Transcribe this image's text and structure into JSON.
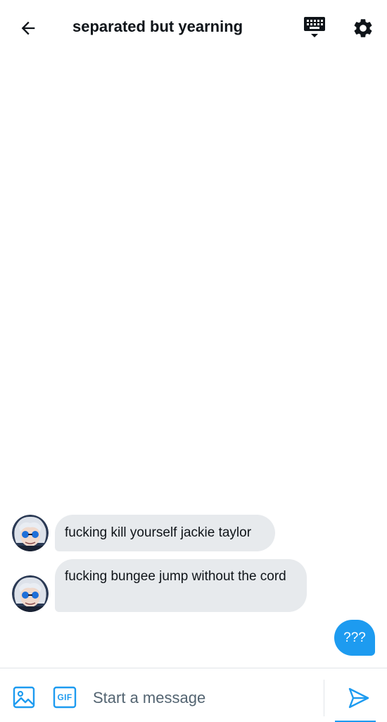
{
  "header": {
    "title": "separated but yearning",
    "back_icon": "arrow-left-icon",
    "keyboard_icon": "keyboard-icon",
    "settings_icon": "gear-icon"
  },
  "messages": [
    {
      "direction": "incoming",
      "text": "fucking kill yourself jackie taylor"
    },
    {
      "direction": "incoming",
      "text": "fucking bungee jump without the cord"
    },
    {
      "direction": "outgoing",
      "text": "???"
    }
  ],
  "composer": {
    "placeholder": "Start a message",
    "value": "",
    "gif_label": "GIF",
    "media_icon": "image-icon",
    "send_icon": "send-icon"
  },
  "colors": {
    "accent": "#1d9bf0",
    "incoming_bubble": "#e7eaed",
    "text": "#0f1419",
    "placeholder": "#536471"
  }
}
